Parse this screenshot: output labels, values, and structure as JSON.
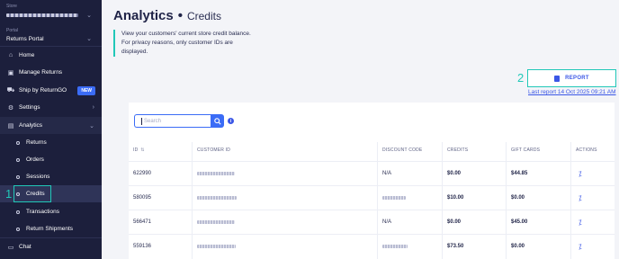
{
  "sidebar": {
    "store_label": "Store",
    "portal_label": "Portal",
    "portal_value": "Returns Portal",
    "nav": [
      {
        "label": "Home",
        "icon": "home-icon"
      },
      {
        "label": "Manage Returns",
        "icon": "returns-box-icon"
      },
      {
        "label": "Ship by ReturnGO",
        "icon": "truck-icon",
        "badge": "NEW"
      },
      {
        "label": "Settings",
        "icon": "gear-icon"
      },
      {
        "label": "Analytics",
        "icon": "chart-icon"
      }
    ],
    "analytics_sub": [
      "Returns",
      "Orders",
      "Sessions",
      "Credits",
      "Transactions",
      "Return Shipments"
    ],
    "chat_label": "Chat"
  },
  "callouts": {
    "one": "1",
    "two": "2"
  },
  "header": {
    "title": "Analytics",
    "separator": "•",
    "subtitle": "Credits"
  },
  "info": {
    "line1": "View your customers' current store credit balance.",
    "line2": "For privacy reasons, only customer IDs are displayed."
  },
  "report": {
    "button_label": "REPORT",
    "last_report": "Last report 14 Oct 2025 09:21 AM"
  },
  "search": {
    "placeholder": "Search"
  },
  "table": {
    "headers": {
      "id": "ID",
      "customer_id": "CUSTOMER ID",
      "discount_code": "DISCOUNT CODE",
      "credits": "CREDITS",
      "gift_cards": "GIFT CARDS",
      "actions": "ACTIONS"
    },
    "rows": [
      {
        "id": "622990",
        "discount_code": "N/A",
        "credits": "$0.00",
        "gift_cards": "$44.85"
      },
      {
        "id": "580095",
        "discount_code": "",
        "credits": "$10.00",
        "gift_cards": "$0.00"
      },
      {
        "id": "566471",
        "discount_code": "N/A",
        "credits": "$0.00",
        "gift_cards": "$45.00"
      },
      {
        "id": "559136",
        "discount_code": "",
        "credits": "$73.50",
        "gift_cards": "$0.00"
      }
    ]
  },
  "colors": {
    "sidebar_bg": "#1c1f3c",
    "accent_blue": "#3b6cf6",
    "callout_teal": "#21c8b8"
  }
}
